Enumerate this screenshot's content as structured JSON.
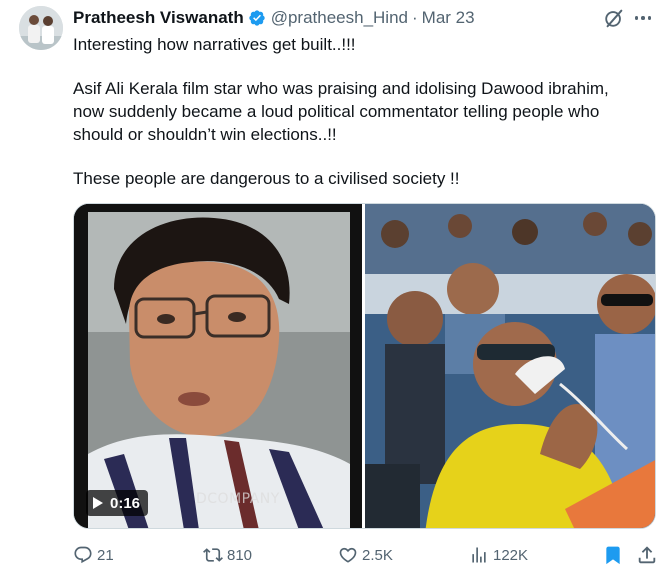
{
  "tweet": {
    "author_name": "Pratheesh Viswanath",
    "handle": "@pratheesh_Hind",
    "separator": "·",
    "date": "Mar 23",
    "text_lines": [
      "Interesting how narratives get built..!!!",
      "Asif Ali Kerala film star who was praising and idolising Dawood ibrahim,",
      "now suddenly became a loud political commentator telling people who",
      "should or shouldn’t win elections..!!",
      "These people are dangerous to a civilised society !!"
    ]
  },
  "media": {
    "video_duration": "0:16",
    "watermark": "DCOMPANY"
  },
  "actions": {
    "replies": "21",
    "reposts": "810",
    "likes": "2.5K",
    "views": "122K"
  },
  "icons": {
    "verified": "verified-badge-icon",
    "grok": "grok-icon",
    "more": "more-icon",
    "reply": "reply-icon",
    "repost": "repost-icon",
    "like": "like-icon",
    "views": "views-icon",
    "bookmark": "bookmark-icon",
    "share": "share-icon"
  },
  "colors": {
    "accent": "#1d9bf0",
    "text": "#0f1419",
    "muted": "#536471",
    "bookmark_active": "#1d9bf0"
  }
}
